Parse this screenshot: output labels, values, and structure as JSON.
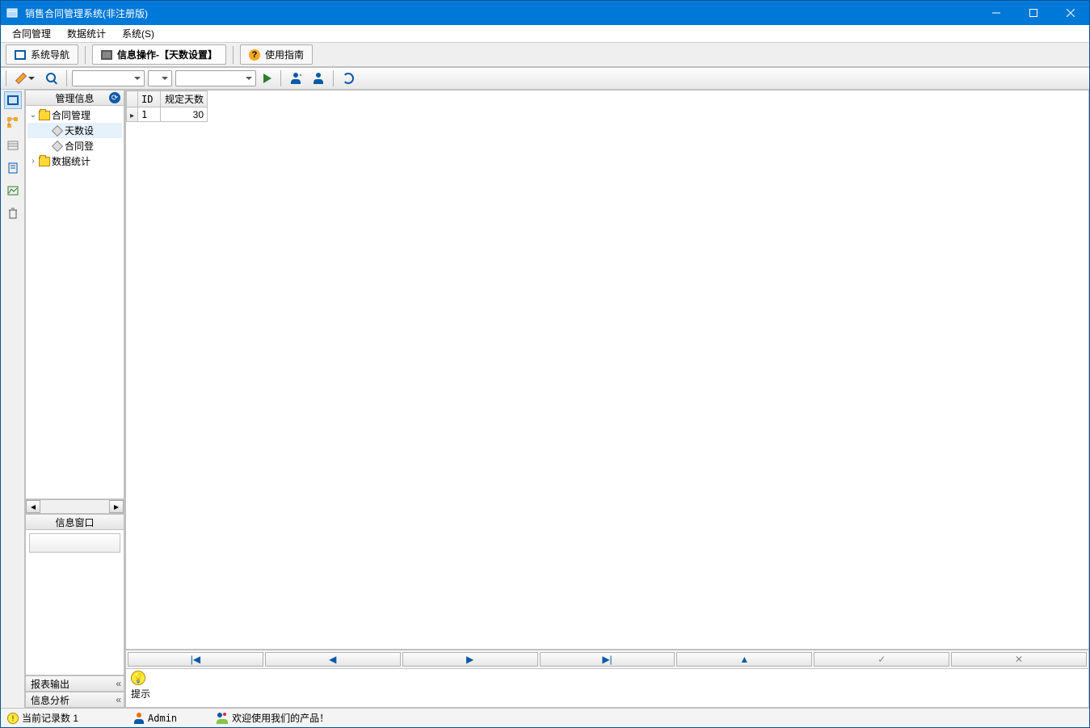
{
  "titlebar": {
    "title": "销售合同管理系统(非注册版)"
  },
  "menubar": {
    "items": [
      "合同管理",
      "数据统计",
      "系统(S)"
    ]
  },
  "tabs": {
    "nav": "系统导航",
    "info": "信息操作-【天数设置】",
    "guide": "使用指南"
  },
  "leftpanel": {
    "header": "管理信息",
    "tree": {
      "root1": "合同管理",
      "leaf1": "天数设",
      "leaf2": "合同登",
      "root2": "数据统计"
    },
    "info_window": "信息窗口",
    "report_output": "报表输出",
    "info_analysis": "信息分析"
  },
  "grid": {
    "col_id": "ID",
    "col_days": "规定天数",
    "rows": [
      {
        "id": "1",
        "days": "30"
      }
    ]
  },
  "hint": {
    "label": "提示"
  },
  "statusbar": {
    "records": "当前记录数 1",
    "user": "Admin",
    "welcome": "欢迎使用我们的产品！"
  }
}
